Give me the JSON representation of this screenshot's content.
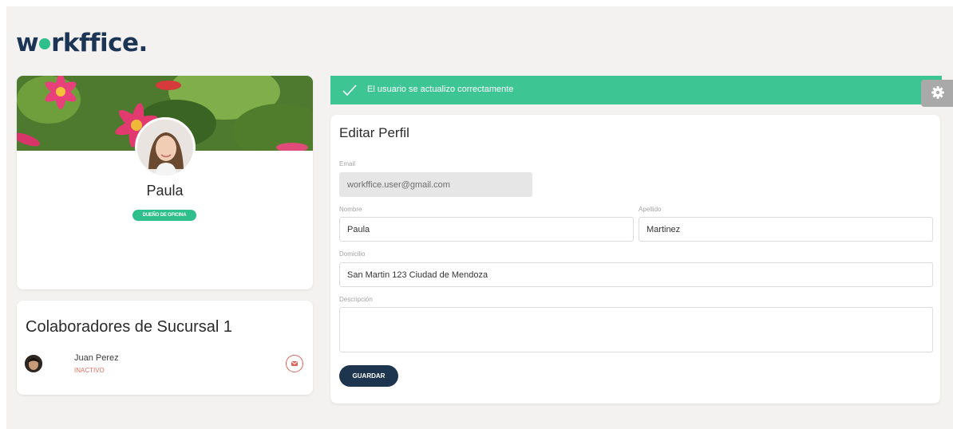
{
  "brand": {
    "logo_text_pre": "w",
    "logo_text_post": "rkffice.",
    "logo_dot_color": "#2fbf8c",
    "logo_color": "#1c3555"
  },
  "profile": {
    "name": "Paula",
    "role_badge": "DUEÑO DE OFICINA",
    "cover_image": "flowers-photo",
    "avatar_image": "woman-portrait"
  },
  "collaborators": {
    "title": "Colaboradores de Sucursal 1",
    "items": [
      {
        "name": "Juan Perez",
        "status": "INACTIVO",
        "action_icon": "mail-icon"
      }
    ]
  },
  "alert": {
    "message": "El usuario se actualizo correctamente",
    "icon": "check-icon",
    "close": "×",
    "color": "#3ec594"
  },
  "settings": {
    "icon": "gear-icon"
  },
  "form": {
    "title": "Editar Perfil",
    "email": {
      "label": "Email",
      "value": "workffice.user@gmail.com"
    },
    "nombre": {
      "label": "Nombre",
      "value": "Paula"
    },
    "apellido": {
      "label": "Apellido",
      "value": "Martinez"
    },
    "domicilio": {
      "label": "Domicilio",
      "value": "San Martin 123 Ciudad de Mendoza"
    },
    "descripcion": {
      "label": "Descripción",
      "value": ""
    },
    "submit_label": "GUARDAR"
  }
}
